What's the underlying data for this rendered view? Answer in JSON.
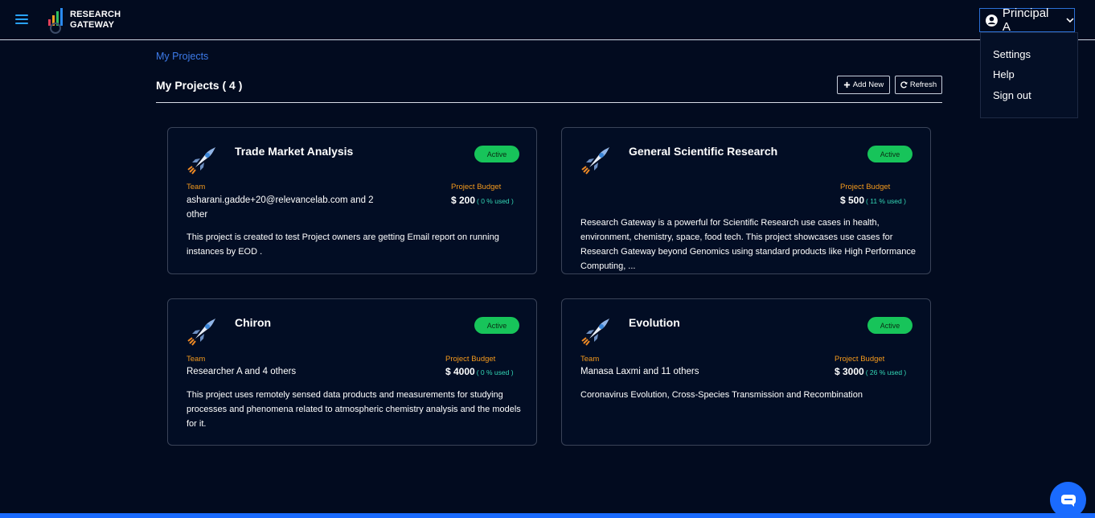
{
  "header": {
    "logo_line1": "RESEARCH",
    "logo_line2": "GATEWAY",
    "user_name": "Principal A",
    "menu": [
      "Settings",
      "Help",
      "Sign out"
    ]
  },
  "breadcrumb": "My Projects",
  "page_title": "My Projects ( 4 )",
  "buttons": {
    "add_new": "Add New",
    "refresh": "Refresh"
  },
  "labels": {
    "team": "Team",
    "budget": "Project Budget"
  },
  "projects": [
    {
      "title": "Trade Market Analysis",
      "status": "Active",
      "team_line1": "asharani.gadde+20@relevancelab.com and 2",
      "team_line2": "other",
      "budget": "$ 200",
      "used": "( 0 % used )",
      "desc_lines": [
        "This project is created to test Project owners are getting Email report on running",
        "instances by EOD ."
      ]
    },
    {
      "title": "General Scientific Research",
      "status": "Active",
      "team_line1": "",
      "team_line2": "",
      "budget": "$ 500",
      "used": "( 11 % used )",
      "desc_lines": [
        "Research Gateway is a powerful for Scientific Research use cases in health,",
        "environment, chemistry, space, food tech. This project showcases use cases for",
        "Research Gateway beyond Genomics using standard products like High Performance",
        "Computing, ..."
      ]
    },
    {
      "title": "Chiron",
      "status": "Active",
      "team_line1": "Researcher A and 4 others",
      "team_line2": "",
      "budget": "$ 4000",
      "used": "( 0 % used )",
      "desc_lines": [
        "This project uses remotely sensed data products and measurements for studying",
        "processes and phenomena related to atmospheric chemistry analysis and the models",
        "for it."
      ]
    },
    {
      "title": "Evolution",
      "status": "Active",
      "team_line1": "Manasa Laxmi and 11 others",
      "team_line2": "",
      "budget": "$ 3000",
      "used": "( 26 % used )",
      "desc_lines": [
        "Coronavirus Evolution, Cross-Species Transmission and Recombination"
      ]
    }
  ],
  "colors": {
    "background": "#020b1f",
    "accent_blue": "#1a6bff",
    "status_green": "#17c45a",
    "label_orange": "#f59a1c",
    "used_teal": "#33d6b5"
  },
  "icons": [
    "menu-icon",
    "logo-icon",
    "user-circle-icon",
    "chevron-down-icon",
    "plus-icon",
    "refresh-icon",
    "rocket-icon",
    "chat-icon"
  ]
}
